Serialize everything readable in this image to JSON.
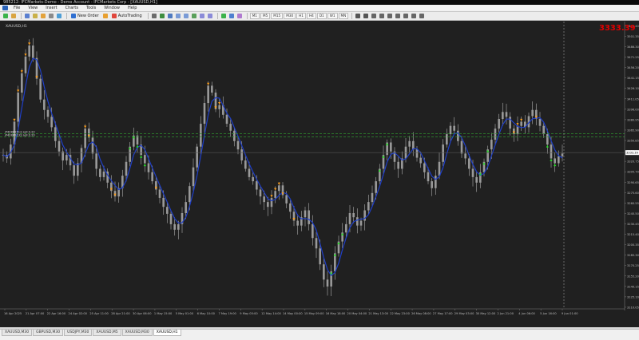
{
  "window": {
    "title": "985212: IFCMarkets-Demo - Demo Account - IFCMarkets Corp - [XAUUSD,H1]"
  },
  "menu": [
    "File",
    "View",
    "Insert",
    "Charts",
    "Tools",
    "Window",
    "Help"
  ],
  "toolbar": {
    "new_order": "New Order",
    "auto_trading": "AutoTrading",
    "timeframes": [
      "M1",
      "M5",
      "M15",
      "M30",
      "H1",
      "H4",
      "D1",
      "W1",
      "MN"
    ]
  },
  "chart": {
    "symbol_label": "XAUUSD,H1",
    "current_price": "3333.39",
    "order_lines": [
      {
        "label": "#40885513 sell 0.20",
        "price": 3360.8
      },
      {
        "label": "#40885133 sell 0.20",
        "price": 3356.2
      }
    ],
    "price_labels": [
      "3516.40",
      "3501.35",
      "3486.30",
      "3471.25",
      "3456.20",
      "3441.15",
      "3426.10",
      "3411.05",
      "3396.00",
      "3380.95",
      "3365.90",
      "3350.85",
      "3335.80",
      "3320.75",
      "3305.70",
      "3290.65",
      "3275.60",
      "3260.55",
      "3245.50",
      "3230.45",
      "3215.40",
      "3200.35",
      "3185.30",
      "3170.25",
      "3155.20",
      "3140.15",
      "3125.10",
      "3110.05"
    ],
    "bid_box": "3333.39",
    "time_labels": [
      "16 Apr 2025",
      "21 Apr 07:00",
      "22 Apr 16:00",
      "24 Apr 02:00",
      "25 Apr 11:00",
      "28 Apr 21:00",
      "30 Apr 06:00",
      "1 May 15:00",
      "5 May 01:00",
      "6 May 10:00",
      "7 May 19:00",
      "9 May 05:00",
      "12 May 14:00",
      "14 May 00:00",
      "15 May 09:00",
      "16 May 18:00",
      "20 May 04:00",
      "21 May 13:00",
      "22 May 23:00",
      "26 May 08:00",
      "27 May 17:00",
      "29 May 03:00",
      "30 May 12:00",
      "2 Jun 21:00",
      "4 Jun 06:00",
      "5 Jun 16:00",
      "9 Jun 01:00"
    ],
    "colors": {
      "background": "#202020",
      "candles": "#9a9a9a",
      "ma": "#1f3fc8",
      "sell_arrow": "#ff9f1a",
      "buy_arrow": "#28e028",
      "order_line": "#2f8f2f",
      "price_text": "#e00000"
    },
    "close_series": [
      3330,
      3325,
      3345,
      3378,
      3420,
      3448,
      3472,
      3488,
      3470,
      3440,
      3410,
      3395,
      3385,
      3370,
      3350,
      3335,
      3322,
      3330,
      3315,
      3300,
      3318,
      3340,
      3368,
      3355,
      3332,
      3310,
      3298,
      3306,
      3290,
      3278,
      3270,
      3282,
      3300,
      3320,
      3342,
      3358,
      3345,
      3330,
      3318,
      3305,
      3292,
      3280,
      3268,
      3255,
      3245,
      3230,
      3222,
      3230,
      3246,
      3262,
      3285,
      3312,
      3342,
      3375,
      3405,
      3430,
      3420,
      3396,
      3402,
      3388,
      3375,
      3365,
      3350,
      3338,
      3322,
      3310,
      3298,
      3292,
      3280,
      3270,
      3262,
      3255,
      3268,
      3278,
      3286,
      3272,
      3260,
      3248,
      3235,
      3228,
      3240,
      3250,
      3230,
      3210,
      3195,
      3172,
      3150,
      3140,
      3162,
      3188,
      3205,
      3218,
      3230,
      3246,
      3240,
      3228,
      3235,
      3250,
      3262,
      3275,
      3292,
      3310,
      3330,
      3348,
      3335,
      3320,
      3310,
      3325,
      3342,
      3350,
      3338,
      3326,
      3318,
      3305,
      3292,
      3282,
      3300,
      3320,
      3345,
      3360,
      3372,
      3365,
      3350,
      3332,
      3325,
      3310,
      3298,
      3290,
      3305,
      3320,
      3338,
      3352,
      3368,
      3382,
      3392,
      3385,
      3368,
      3360,
      3372,
      3378,
      3370,
      3386,
      3395,
      3382,
      3372,
      3360,
      3345,
      3325,
      3318,
      3328,
      3332
    ]
  },
  "tabs": [
    "XAUUSD,M30",
    "GBPUSD,M30",
    "USDJPY,M30",
    "XAUUSD,M5",
    "XAUUSD,M30",
    "XAUUSD,H1"
  ],
  "active_tab": 5
}
